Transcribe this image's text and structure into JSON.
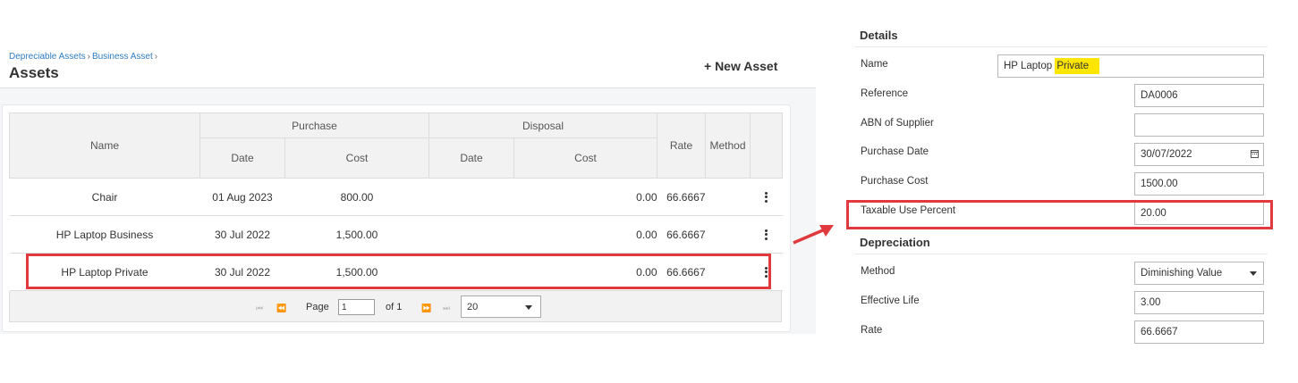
{
  "breadcrumb": {
    "items": [
      "Depreciable Assets",
      "Business Asset"
    ],
    "separator": "›"
  },
  "page": {
    "title": "Assets",
    "new_asset_label": "+ New Asset"
  },
  "table": {
    "group_headers": {
      "purchase": "Purchase",
      "disposal": "Disposal"
    },
    "columns": {
      "name": "Name",
      "purchase_date": "Date",
      "purchase_cost": "Cost",
      "disposal_date": "Date",
      "disposal_cost": "Cost",
      "rate": "Rate",
      "method": "Method"
    },
    "rows": [
      {
        "name": "Chair",
        "purchase_date": "01 Aug 2023",
        "purchase_cost": "800.00",
        "disposal_date": "",
        "disposal_cost": "0.00",
        "rate": "66.6667",
        "method": ""
      },
      {
        "name": "HP Laptop Business",
        "purchase_date": "30 Jul 2022",
        "purchase_cost": "1,500.00",
        "disposal_date": "",
        "disposal_cost": "0.00",
        "rate": "66.6667",
        "method": ""
      },
      {
        "name": "HP Laptop Private",
        "purchase_date": "30 Jul 2022",
        "purchase_cost": "1,500.00",
        "disposal_date": "",
        "disposal_cost": "0.00",
        "rate": "66.6667",
        "method": ""
      }
    ]
  },
  "pager": {
    "first_icon": "⏮",
    "prev_icon": "⏪",
    "next_icon": "⏩",
    "last_icon": "⏭",
    "page_label": "Page",
    "page_value": "1",
    "of_label": "of 1",
    "page_size": "20"
  },
  "details": {
    "title": "Details",
    "fields": {
      "name": {
        "label": "Name",
        "value_plain": "HP Laptop ",
        "value_highlight": "Private"
      },
      "reference": {
        "label": "Reference",
        "value": "DA0006"
      },
      "abn": {
        "label": "ABN of Supplier",
        "value": ""
      },
      "purchase_date": {
        "label": "Purchase Date",
        "value": "30/07/2022"
      },
      "purchase_cost": {
        "label": "Purchase Cost",
        "value": "1500.00"
      },
      "taxable_use": {
        "label": "Taxable Use Percent",
        "value": "20.00"
      }
    }
  },
  "depreciation": {
    "title": "Depreciation",
    "fields": {
      "method": {
        "label": "Method",
        "value": "Diminishing Value"
      },
      "effective_life": {
        "label": "Effective Life",
        "value": "3.00"
      },
      "rate": {
        "label": "Rate",
        "value": "66.6667"
      }
    }
  },
  "colors": {
    "annotation_red": "#e03a3e",
    "highlight_yellow": "#ffe600",
    "link_blue": "#2f7dc4"
  }
}
